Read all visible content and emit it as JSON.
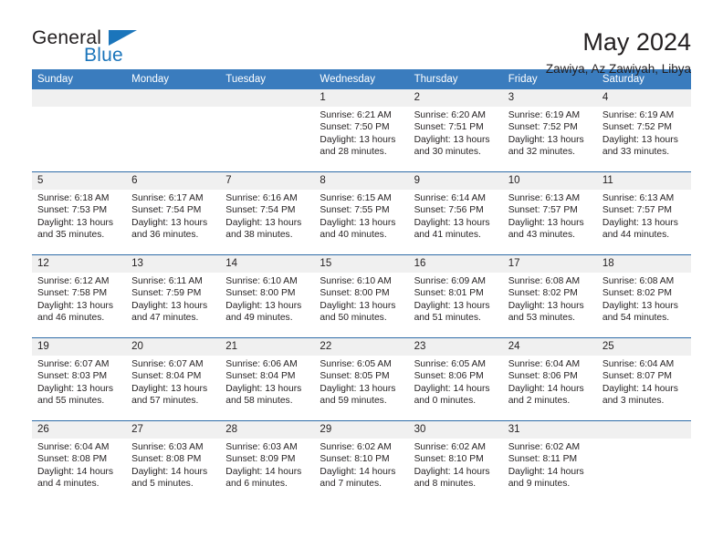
{
  "brand": {
    "name_top": "General",
    "name_bottom": "Blue",
    "accent_color": "#1b75bb"
  },
  "header": {
    "title": "May 2024",
    "location": "Zawiya, Az Zawiyah, Libya"
  },
  "theme": {
    "header_band": "#3a7cbe",
    "row_divider": "#2f6ca8",
    "day_number_band": "#f0f0f0",
    "text": "#231f20"
  },
  "calendar": {
    "weekday_headers": [
      "Sunday",
      "Monday",
      "Tuesday",
      "Wednesday",
      "Thursday",
      "Friday",
      "Saturday"
    ],
    "weeks": [
      [
        {
          "day": "",
          "lines": [
            "",
            "",
            "",
            ""
          ]
        },
        {
          "day": "",
          "lines": [
            "",
            "",
            "",
            ""
          ]
        },
        {
          "day": "",
          "lines": [
            "",
            "",
            "",
            ""
          ]
        },
        {
          "day": "1",
          "lines": [
            "Sunrise: 6:21 AM",
            "Sunset: 7:50 PM",
            "Daylight: 13 hours",
            "and 28 minutes."
          ]
        },
        {
          "day": "2",
          "lines": [
            "Sunrise: 6:20 AM",
            "Sunset: 7:51 PM",
            "Daylight: 13 hours",
            "and 30 minutes."
          ]
        },
        {
          "day": "3",
          "lines": [
            "Sunrise: 6:19 AM",
            "Sunset: 7:52 PM",
            "Daylight: 13 hours",
            "and 32 minutes."
          ]
        },
        {
          "day": "4",
          "lines": [
            "Sunrise: 6:19 AM",
            "Sunset: 7:52 PM",
            "Daylight: 13 hours",
            "and 33 minutes."
          ]
        }
      ],
      [
        {
          "day": "5",
          "lines": [
            "Sunrise: 6:18 AM",
            "Sunset: 7:53 PM",
            "Daylight: 13 hours",
            "and 35 minutes."
          ]
        },
        {
          "day": "6",
          "lines": [
            "Sunrise: 6:17 AM",
            "Sunset: 7:54 PM",
            "Daylight: 13 hours",
            "and 36 minutes."
          ]
        },
        {
          "day": "7",
          "lines": [
            "Sunrise: 6:16 AM",
            "Sunset: 7:54 PM",
            "Daylight: 13 hours",
            "and 38 minutes."
          ]
        },
        {
          "day": "8",
          "lines": [
            "Sunrise: 6:15 AM",
            "Sunset: 7:55 PM",
            "Daylight: 13 hours",
            "and 40 minutes."
          ]
        },
        {
          "day": "9",
          "lines": [
            "Sunrise: 6:14 AM",
            "Sunset: 7:56 PM",
            "Daylight: 13 hours",
            "and 41 minutes."
          ]
        },
        {
          "day": "10",
          "lines": [
            "Sunrise: 6:13 AM",
            "Sunset: 7:57 PM",
            "Daylight: 13 hours",
            "and 43 minutes."
          ]
        },
        {
          "day": "11",
          "lines": [
            "Sunrise: 6:13 AM",
            "Sunset: 7:57 PM",
            "Daylight: 13 hours",
            "and 44 minutes."
          ]
        }
      ],
      [
        {
          "day": "12",
          "lines": [
            "Sunrise: 6:12 AM",
            "Sunset: 7:58 PM",
            "Daylight: 13 hours",
            "and 46 minutes."
          ]
        },
        {
          "day": "13",
          "lines": [
            "Sunrise: 6:11 AM",
            "Sunset: 7:59 PM",
            "Daylight: 13 hours",
            "and 47 minutes."
          ]
        },
        {
          "day": "14",
          "lines": [
            "Sunrise: 6:10 AM",
            "Sunset: 8:00 PM",
            "Daylight: 13 hours",
            "and 49 minutes."
          ]
        },
        {
          "day": "15",
          "lines": [
            "Sunrise: 6:10 AM",
            "Sunset: 8:00 PM",
            "Daylight: 13 hours",
            "and 50 minutes."
          ]
        },
        {
          "day": "16",
          "lines": [
            "Sunrise: 6:09 AM",
            "Sunset: 8:01 PM",
            "Daylight: 13 hours",
            "and 51 minutes."
          ]
        },
        {
          "day": "17",
          "lines": [
            "Sunrise: 6:08 AM",
            "Sunset: 8:02 PM",
            "Daylight: 13 hours",
            "and 53 minutes."
          ]
        },
        {
          "day": "18",
          "lines": [
            "Sunrise: 6:08 AM",
            "Sunset: 8:02 PM",
            "Daylight: 13 hours",
            "and 54 minutes."
          ]
        }
      ],
      [
        {
          "day": "19",
          "lines": [
            "Sunrise: 6:07 AM",
            "Sunset: 8:03 PM",
            "Daylight: 13 hours",
            "and 55 minutes."
          ]
        },
        {
          "day": "20",
          "lines": [
            "Sunrise: 6:07 AM",
            "Sunset: 8:04 PM",
            "Daylight: 13 hours",
            "and 57 minutes."
          ]
        },
        {
          "day": "21",
          "lines": [
            "Sunrise: 6:06 AM",
            "Sunset: 8:04 PM",
            "Daylight: 13 hours",
            "and 58 minutes."
          ]
        },
        {
          "day": "22",
          "lines": [
            "Sunrise: 6:05 AM",
            "Sunset: 8:05 PM",
            "Daylight: 13 hours",
            "and 59 minutes."
          ]
        },
        {
          "day": "23",
          "lines": [
            "Sunrise: 6:05 AM",
            "Sunset: 8:06 PM",
            "Daylight: 14 hours",
            "and 0 minutes."
          ]
        },
        {
          "day": "24",
          "lines": [
            "Sunrise: 6:04 AM",
            "Sunset: 8:06 PM",
            "Daylight: 14 hours",
            "and 2 minutes."
          ]
        },
        {
          "day": "25",
          "lines": [
            "Sunrise: 6:04 AM",
            "Sunset: 8:07 PM",
            "Daylight: 14 hours",
            "and 3 minutes."
          ]
        }
      ],
      [
        {
          "day": "26",
          "lines": [
            "Sunrise: 6:04 AM",
            "Sunset: 8:08 PM",
            "Daylight: 14 hours",
            "and 4 minutes."
          ]
        },
        {
          "day": "27",
          "lines": [
            "Sunrise: 6:03 AM",
            "Sunset: 8:08 PM",
            "Daylight: 14 hours",
            "and 5 minutes."
          ]
        },
        {
          "day": "28",
          "lines": [
            "Sunrise: 6:03 AM",
            "Sunset: 8:09 PM",
            "Daylight: 14 hours",
            "and 6 minutes."
          ]
        },
        {
          "day": "29",
          "lines": [
            "Sunrise: 6:02 AM",
            "Sunset: 8:10 PM",
            "Daylight: 14 hours",
            "and 7 minutes."
          ]
        },
        {
          "day": "30",
          "lines": [
            "Sunrise: 6:02 AM",
            "Sunset: 8:10 PM",
            "Daylight: 14 hours",
            "and 8 minutes."
          ]
        },
        {
          "day": "31",
          "lines": [
            "Sunrise: 6:02 AM",
            "Sunset: 8:11 PM",
            "Daylight: 14 hours",
            "and 9 minutes."
          ]
        },
        {
          "day": "",
          "lines": [
            "",
            "",
            "",
            ""
          ]
        }
      ]
    ]
  }
}
